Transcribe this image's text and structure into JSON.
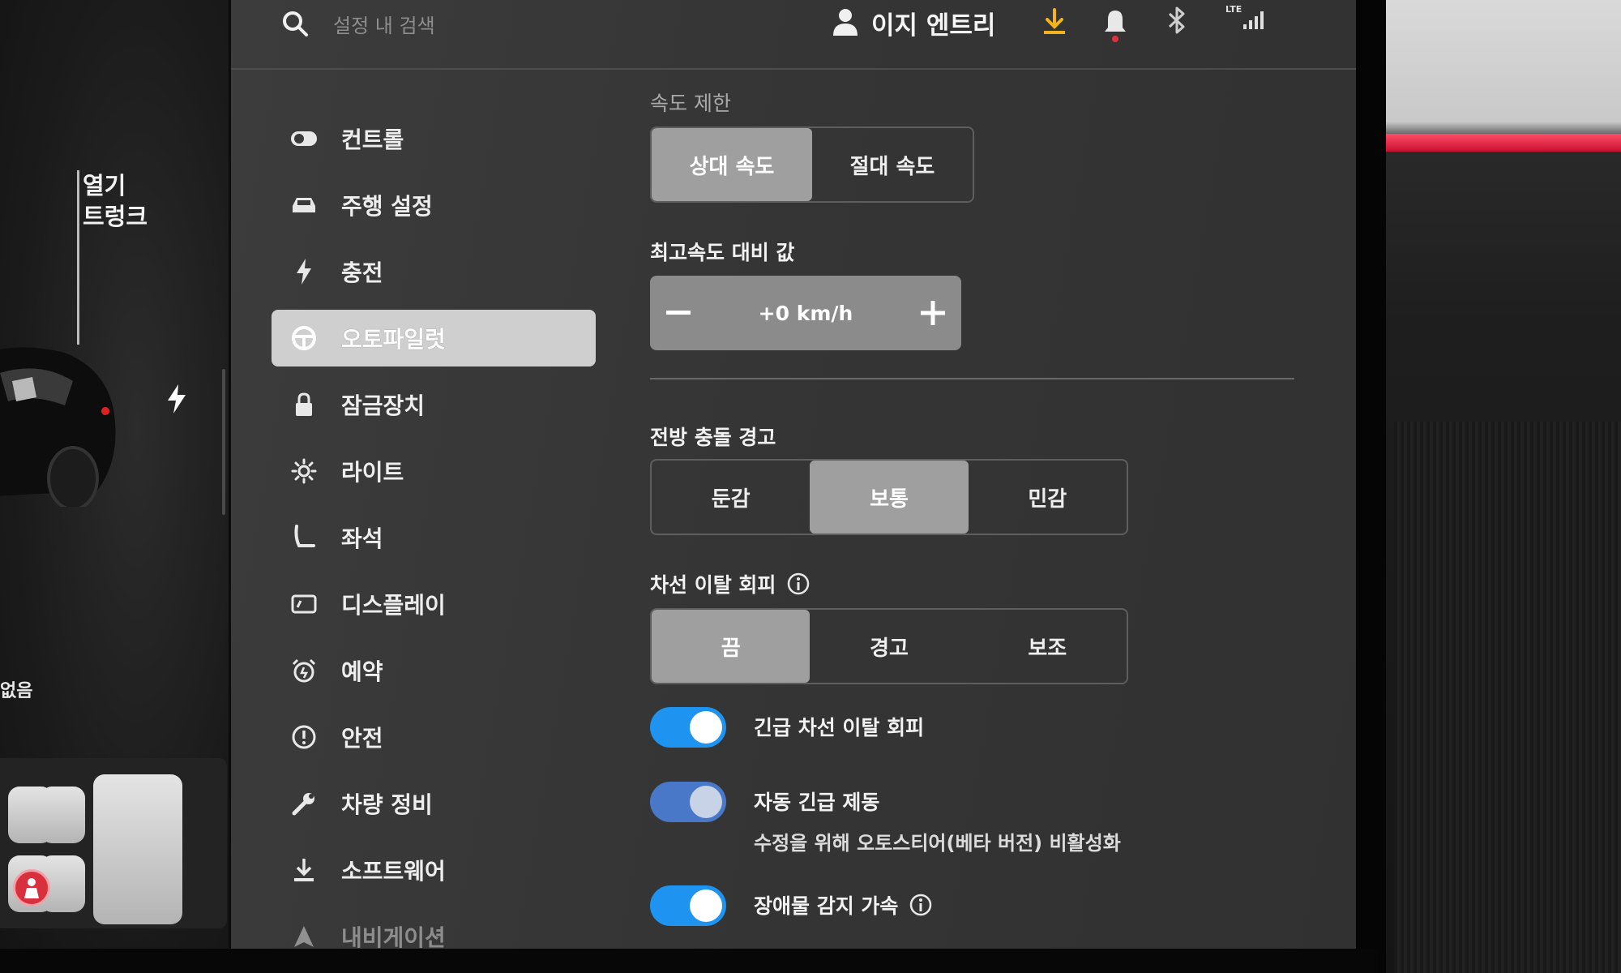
{
  "colors": {
    "accent": "#1e93f0",
    "active_nav": "#cfcfcf",
    "selected_segment": "#9f9f9f"
  },
  "left_panel": {
    "trunk_label_line1": "열기",
    "trunk_label_line2": "트렁크",
    "status_text": "없음"
  },
  "topbar": {
    "search_placeholder": "설정 내 검색",
    "profile_name": "이지 엔트리",
    "signal_label": "LTE",
    "icons": [
      "search-icon",
      "profile-icon",
      "download-icon",
      "bell-icon",
      "bluetooth-icon",
      "lte-signal-icon"
    ]
  },
  "sidebar": {
    "items": [
      {
        "label": "컨트롤",
        "icon": "toggle-icon"
      },
      {
        "label": "주행 설정",
        "icon": "car-icon"
      },
      {
        "label": "충전",
        "icon": "bolt-icon"
      },
      {
        "label": "오토파일럿",
        "icon": "steering-wheel-icon",
        "active": true
      },
      {
        "label": "잠금장치",
        "icon": "lock-icon"
      },
      {
        "label": "라이트",
        "icon": "sun-icon"
      },
      {
        "label": "좌석",
        "icon": "seat-icon"
      },
      {
        "label": "디스플레이",
        "icon": "display-icon"
      },
      {
        "label": "예약",
        "icon": "alarm-icon"
      },
      {
        "label": "안전",
        "icon": "alert-icon"
      },
      {
        "label": "차량 정비",
        "icon": "wrench-icon"
      },
      {
        "label": "소프트웨어",
        "icon": "download-icon"
      },
      {
        "label": "내비게이션",
        "icon": "navigation-icon"
      }
    ]
  },
  "speed_limit": {
    "title": "속도 제한",
    "options": [
      "상대 속도",
      "절대 속도"
    ],
    "selected": "상대 속도"
  },
  "offset": {
    "title": "최고속도 대비 값",
    "value": "+0 km/h",
    "minus_label": "−",
    "plus_label": "+"
  },
  "forward_collision": {
    "title": "전방 충돌 경고",
    "options": [
      "둔감",
      "보통",
      "민감"
    ],
    "selected": "보통"
  },
  "lane_departure": {
    "title": "차선 이탈 회피",
    "options": [
      "끔",
      "경고",
      "보조"
    ],
    "selected": "끔"
  },
  "toggles": {
    "emergency_lane": {
      "label": "긴급 차선 이탈 회피",
      "on": true
    },
    "auto_brake": {
      "label": "자동 긴급 제동",
      "sub": "수정을 위해 오토스티어(베타 버전) 비활성화",
      "on": true,
      "disabled": true
    },
    "obstacle_accel": {
      "label": "장애물 감지 가속",
      "on": true
    }
  }
}
